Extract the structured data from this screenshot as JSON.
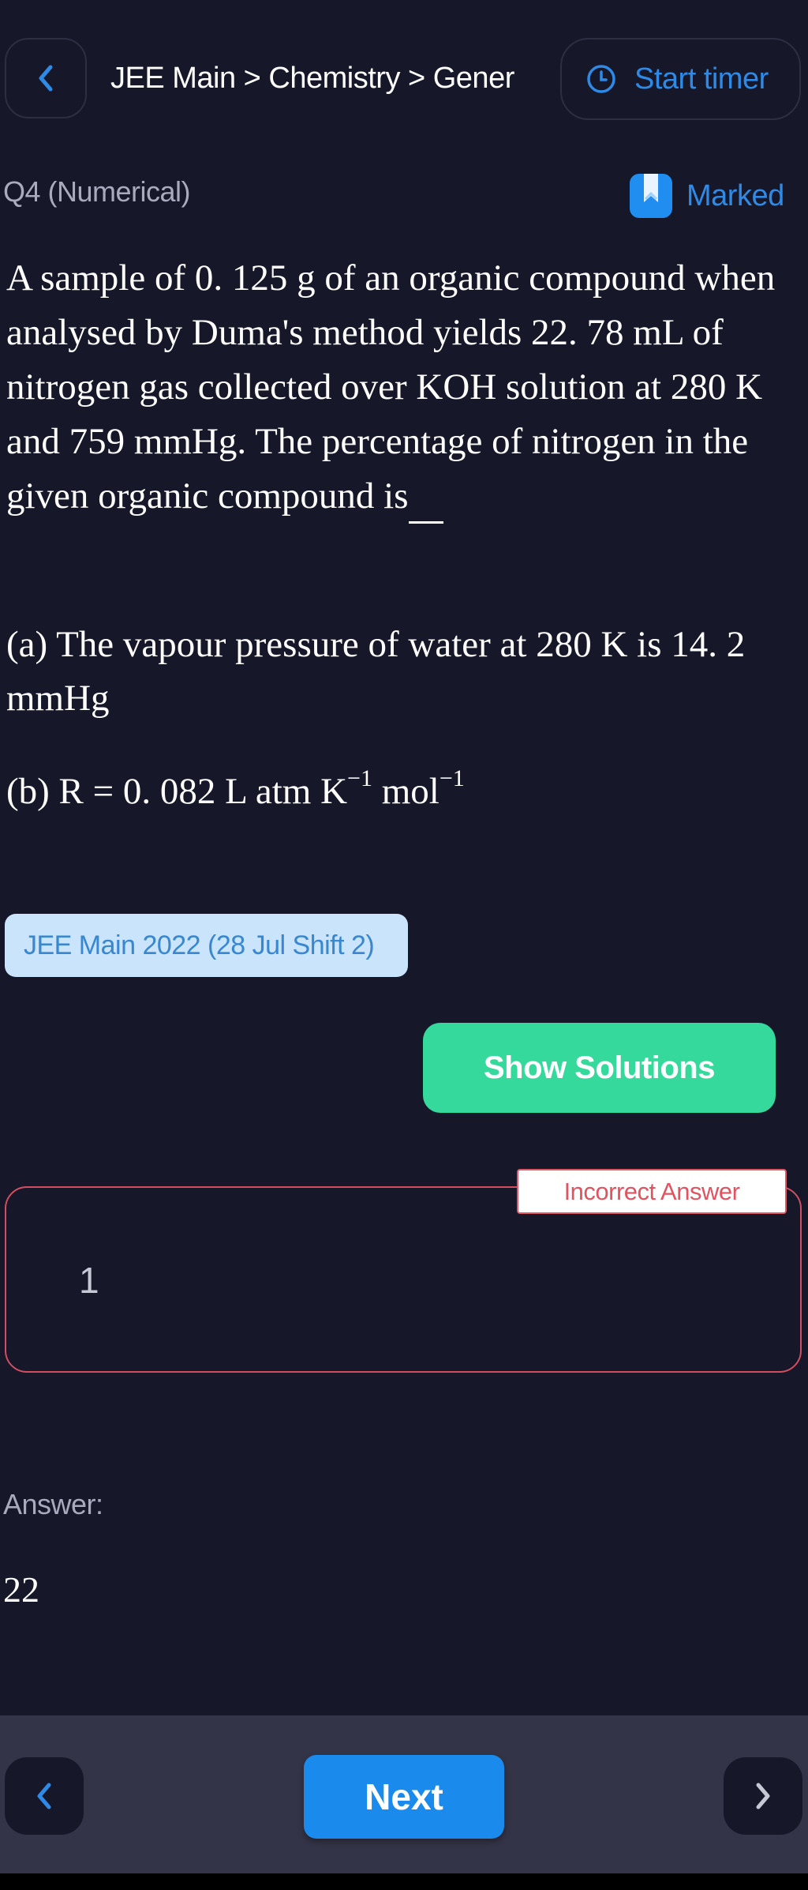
{
  "header": {
    "breadcrumb": "JEE Main > Chemistry > Gener",
    "timer_label": "Start timer",
    "icons": {
      "back": "chevron-left-icon",
      "timer": "clock-icon"
    }
  },
  "question": {
    "label": "Q4 (Numerical)",
    "marked_label": "Marked",
    "marked_icon": "bookmark-icon",
    "text": "A sample of 0. 125 g of an organic compound when analysed by Duma's method yields 22. 78  mL of nitrogen gas collected over KOH solution at 280 K and 759 mmHg. The percentage of nitrogen in the given organic compound is",
    "hint_a": "(a) The vapour pressure of water at 280 K is 14. 2 mmHg",
    "hint_b_prefix": "(b) R = 0. 082 L  atm  K",
    "hint_b_exp1": "−1",
    "hint_b_mid": " mol",
    "hint_b_exp2": "−1",
    "source_tag": "JEE Main 2022 (28 Jul Shift 2)"
  },
  "actions": {
    "show_solutions": "Show Solutions"
  },
  "response": {
    "status": "Incorrect Answer",
    "user_answer": "1",
    "answer_label": "Answer:",
    "correct_answer": "22"
  },
  "footer": {
    "next_label": "Next",
    "icons": {
      "prev": "chevron-left-icon",
      "next": "chevron-right-icon"
    }
  },
  "colors": {
    "background": "#161729",
    "accent_blue": "#1a8aed",
    "success_green": "#34d99b",
    "error_red": "#e0535f",
    "tag_bg": "#c9e4fb"
  }
}
